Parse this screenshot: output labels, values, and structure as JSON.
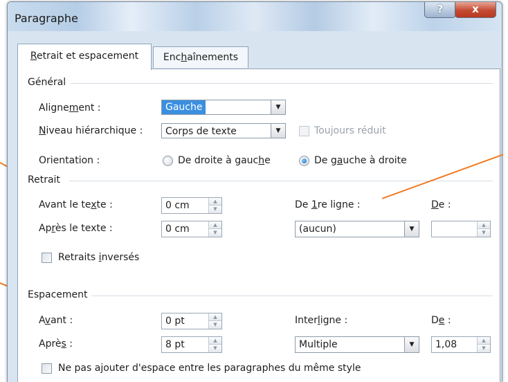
{
  "window": {
    "title": "Paragraphe",
    "help_label": "?",
    "close_label": "x"
  },
  "tabs": [
    {
      "pre": "",
      "key": "R",
      "post": "etrait et espacement",
      "active": true
    },
    {
      "pre": "Enc",
      "key": "h",
      "post": "aînements",
      "active": false
    }
  ],
  "general": {
    "heading": "Général",
    "alignment": {
      "pre": "Aligne",
      "key": "m",
      "post": "ent :",
      "value": "Gauche"
    },
    "outline": {
      "pre": "",
      "key": "N",
      "post": "iveau hiérarchique :",
      "value": "Corps de texte"
    },
    "collapsed": {
      "label": "Toujours réduit",
      "checked": false,
      "enabled": false
    },
    "orientation": {
      "label": "Orientation :",
      "rtl": {
        "pre": "De droite à gauc",
        "key": "h",
        "post": "e",
        "checked": false
      },
      "ltr": {
        "pre": "De g",
        "key": "a",
        "post": "uche à droite",
        "checked": true
      }
    }
  },
  "indent": {
    "heading": "Retrait",
    "before": {
      "pre": "Avant le te",
      "key": "x",
      "post": "te :",
      "value": "0 cm"
    },
    "after": {
      "pre": "Ap",
      "key": "r",
      "post": "ès le texte :",
      "value": "0 cm"
    },
    "first_line": {
      "pre": "De ",
      "key": "1",
      "post": "re ligne :",
      "value": "(aucun)"
    },
    "by": {
      "pre": "",
      "key": "D",
      "post": "e :",
      "value": ""
    },
    "mirror": {
      "pre": "Retraits ",
      "key": "i",
      "post": "nversés",
      "checked": false
    }
  },
  "spacing": {
    "heading": "Espacement",
    "before": {
      "pre": "A",
      "key": "v",
      "post": "ant :",
      "value": "0 pt"
    },
    "after": {
      "pre": "Aprè",
      "key": "s",
      "post": " :",
      "value": "8 pt"
    },
    "line": {
      "pre": "Inter",
      "key": "l",
      "post": "igne :",
      "value": "Multiple"
    },
    "at": {
      "pre": "D",
      "key": "e",
      "post": " :",
      "value": "1,08"
    },
    "no_space": {
      "pre": "Ne pas a",
      "key": "j",
      "post": "outer d'espace entre les paragraphes du même style",
      "checked": false
    }
  },
  "colors": {
    "accent": "#f07a24",
    "selection": "#3b8fe0"
  }
}
